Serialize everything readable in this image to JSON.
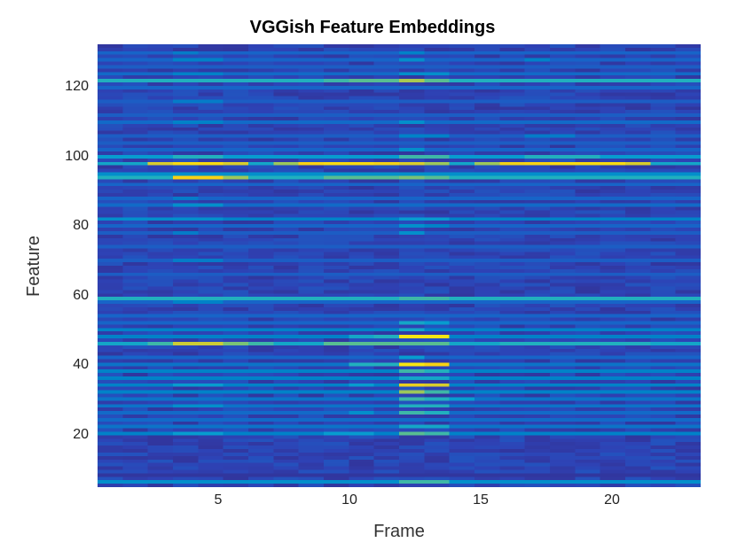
{
  "chart_data": {
    "type": "heatmap",
    "title": "VGGish Feature Embeddings",
    "xlabel": "Frame",
    "ylabel": "Feature",
    "xlim": [
      1,
      24
    ],
    "ylim": [
      1,
      128
    ],
    "x_ticks": [
      5,
      10,
      15,
      20
    ],
    "y_ticks": [
      20,
      40,
      60,
      80,
      100,
      120
    ],
    "n_cols": 24,
    "n_rows": 128,
    "colormap": "parula",
    "vmin": 0.0,
    "vmax": 1.0,
    "baseline_value": 0.05,
    "rows_desc": "Each entry = {r: feature-row (1..128), base: default value for row, cells: optional {col: value} overrides}. Unlisted rows use baseline_value. Values are normalized estimates read from color.",
    "rows": [
      {
        "r": 2,
        "base": 0.35,
        "cells": {
          "13": 0.55,
          "14": 0.55
        }
      },
      {
        "r": 4,
        "base": 0.05
      },
      {
        "r": 16,
        "base": 0.3,
        "cells": {
          "4": 0.4,
          "5": 0.4,
          "10": 0.4,
          "11": 0.4,
          "13": 0.6,
          "14": 0.55
        }
      },
      {
        "r": 18,
        "base": 0.25,
        "cells": {
          "13": 0.45,
          "14": 0.45
        }
      },
      {
        "r": 20,
        "base": 0.22
      },
      {
        "r": 22,
        "base": 0.22,
        "cells": {
          "11": 0.35,
          "13": 0.55,
          "14": 0.5
        }
      },
      {
        "r": 24,
        "base": 0.25,
        "cells": {
          "4": 0.35,
          "5": 0.35,
          "13": 0.5,
          "14": 0.5
        }
      },
      {
        "r": 26,
        "base": 0.25,
        "cells": {
          "13": 0.55,
          "14": 0.5,
          "15": 0.4
        }
      },
      {
        "r": 28,
        "base": 0.3,
        "cells": {
          "13": 0.7,
          "14": 0.55
        }
      },
      {
        "r": 30,
        "base": 0.3,
        "cells": {
          "4": 0.4,
          "5": 0.4,
          "11": 0.4,
          "13": 0.85,
          "14": 0.8
        }
      },
      {
        "r": 32,
        "base": 0.3,
        "cells": {
          "13": 0.45,
          "14": 0.45
        }
      },
      {
        "r": 34,
        "base": 0.3,
        "cells": {
          "13": 0.55,
          "14": 0.5
        }
      },
      {
        "r": 36,
        "base": 0.25,
        "cells": {
          "13": 0.95,
          "14": 0.9,
          "11": 0.5,
          "12": 0.5
        }
      },
      {
        "r": 38,
        "base": 0.2,
        "cells": {
          "13": 0.4
        }
      },
      {
        "r": 42,
        "base": 0.45,
        "cells": {
          "3": 0.55,
          "4": 0.78,
          "5": 0.78,
          "6": 0.65,
          "7": 0.55,
          "10": 0.6,
          "11": 0.6,
          "12": 0.6,
          "13": 0.6,
          "14": 0.6,
          "17": 0.5,
          "18": 0.5,
          "19": 0.5,
          "20": 0.5,
          "21": 0.5,
          "22": 0.5
        }
      },
      {
        "r": 44,
        "base": 0.3,
        "cells": {
          "13": 0.95,
          "14": 0.95,
          "12": 0.5,
          "11": 0.45
        }
      },
      {
        "r": 46,
        "base": 0.3,
        "cells": {
          "13": 0.45
        }
      },
      {
        "r": 48,
        "base": 0.2,
        "cells": {
          "13": 0.45,
          "14": 0.4
        }
      },
      {
        "r": 50,
        "base": 0.2
      },
      {
        "r": 54,
        "base": 0.2,
        "cells": {
          "4": 0.3,
          "5": 0.3
        }
      },
      {
        "r": 55,
        "base": 0.45,
        "cells": {
          "1": 0.5,
          "2": 0.5,
          "3": 0.5,
          "4": 0.5,
          "5": 0.5,
          "6": 0.5,
          "7": 0.5,
          "8": 0.5,
          "9": 0.5,
          "10": 0.5,
          "11": 0.5,
          "12": 0.5,
          "13": 0.55,
          "14": 0.55,
          "15": 0.5,
          "16": 0.5,
          "17": 0.5,
          "18": 0.5,
          "19": 0.5,
          "20": 0.5,
          "21": 0.5,
          "22": 0.5,
          "23": 0.5,
          "24": 0.5
        }
      },
      {
        "r": 62,
        "base": 0.18
      },
      {
        "r": 66,
        "base": 0.18,
        "cells": {
          "4": 0.28,
          "5": 0.28
        }
      },
      {
        "r": 70,
        "base": 0.18
      },
      {
        "r": 74,
        "base": 0.18,
        "cells": {
          "4": 0.28,
          "13": 0.35
        }
      },
      {
        "r": 76,
        "base": 0.2,
        "cells": {
          "13": 0.35,
          "14": 0.3
        }
      },
      {
        "r": 78,
        "base": 0.3,
        "cells": {
          "1": 0.35,
          "2": 0.35,
          "3": 0.35,
          "4": 0.35,
          "5": 0.35,
          "13": 0.4,
          "14": 0.4
        }
      },
      {
        "r": 82,
        "base": 0.22,
        "cells": {
          "4": 0.35,
          "5": 0.35
        }
      },
      {
        "r": 84,
        "base": 0.2,
        "cells": {
          "4": 0.28
        }
      },
      {
        "r": 88,
        "base": 0.2
      },
      {
        "r": 90,
        "base": 0.5,
        "cells": {
          "4": 0.9,
          "5": 0.9,
          "6": 0.7,
          "10": 0.6,
          "11": 0.6,
          "12": 0.6,
          "13": 0.65,
          "14": 0.6
        }
      },
      {
        "r": 91,
        "base": 0.35
      },
      {
        "r": 94,
        "base": 0.45,
        "cells": {
          "3": 0.8,
          "4": 0.92,
          "5": 0.92,
          "6": 0.8,
          "8": 0.7,
          "9": 0.9,
          "10": 0.92,
          "11": 0.92,
          "12": 0.88,
          "13": 0.8,
          "14": 0.7,
          "16": 0.7,
          "17": 0.88,
          "18": 0.9,
          "19": 0.92,
          "20": 0.92,
          "21": 0.92,
          "22": 0.8
        }
      },
      {
        "r": 96,
        "base": 0.4,
        "cells": {
          "4": 0.5,
          "5": 0.5,
          "13": 0.55,
          "14": 0.55,
          "18": 0.5,
          "19": 0.5,
          "20": 0.5
        }
      },
      {
        "r": 98,
        "base": 0.2,
        "cells": {
          "13": 0.35
        }
      },
      {
        "r": 100,
        "base": 0.18
      },
      {
        "r": 102,
        "base": 0.18,
        "cells": {
          "13": 0.3,
          "14": 0.3,
          "18": 0.28,
          "19": 0.28
        }
      },
      {
        "r": 106,
        "base": 0.22,
        "cells": {
          "4": 0.3,
          "5": 0.3,
          "13": 0.35
        }
      },
      {
        "r": 108,
        "base": 0.18
      },
      {
        "r": 112,
        "base": 0.18,
        "cells": {
          "4": 0.28,
          "5": 0.28
        }
      },
      {
        "r": 116,
        "base": 0.2
      },
      {
        "r": 118,
        "base": 0.45,
        "cells": {
          "1": 0.5,
          "2": 0.5,
          "3": 0.5,
          "4": 0.5,
          "5": 0.5,
          "6": 0.5,
          "7": 0.5,
          "8": 0.5,
          "9": 0.5,
          "10": 0.55,
          "11": 0.6,
          "12": 0.6,
          "13": 0.72,
          "14": 0.6,
          "15": 0.5,
          "16": 0.5,
          "17": 0.5,
          "18": 0.5,
          "19": 0.5,
          "20": 0.5,
          "21": 0.5,
          "22": 0.5,
          "23": 0.5,
          "24": 0.5
        }
      },
      {
        "r": 120,
        "base": 0.22,
        "cells": {
          "4": 0.3,
          "5": 0.3,
          "13": 0.35,
          "14": 0.35
        }
      },
      {
        "r": 122,
        "base": 0.18
      },
      {
        "r": 124,
        "base": 0.2,
        "cells": {
          "4": 0.3,
          "5": 0.3,
          "13": 0.35,
          "18": 0.3
        }
      },
      {
        "r": 126,
        "base": 0.2,
        "cells": {
          "4": 0.28,
          "13": 0.3
        }
      }
    ]
  }
}
